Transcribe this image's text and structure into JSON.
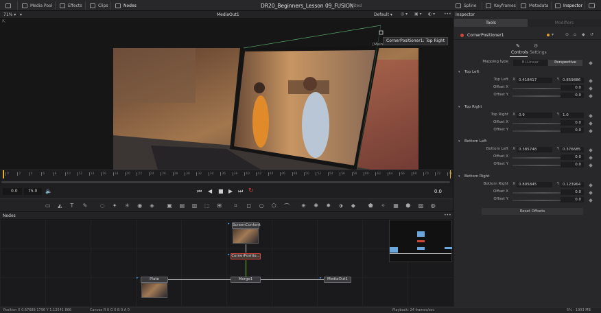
{
  "topbar": {
    "items": [
      "Media Pool",
      "Effects",
      "Clips",
      "Nodes"
    ],
    "title": "DR20_Beginners_Lesson 09_FUSION",
    "status": "Edited",
    "right_items": [
      "Spline",
      "Keyframes",
      "Metadata",
      "Inspector"
    ]
  },
  "viewer": {
    "zoom": "71%",
    "name": "MediaOut1",
    "preset": "Default",
    "tooltip": "CornerPositioner1: Top Right",
    "tag": "[Main"
  },
  "ruler": {
    "ticks": [
      "0",
      "2",
      "4",
      "6",
      "8",
      "10",
      "12",
      "14",
      "16",
      "18",
      "20",
      "22",
      "24",
      "26",
      "28",
      "30",
      "32",
      "34",
      "36",
      "38",
      "40",
      "42",
      "44",
      "46",
      "48",
      "50",
      "52",
      "54",
      "56",
      "58",
      "60",
      "62",
      "64",
      "66",
      "68",
      "70",
      "72",
      "74"
    ]
  },
  "transport": {
    "start": "0.0",
    "end": "75.0",
    "current": "0.0"
  },
  "nodes_panel": {
    "title": "Nodes",
    "screen_content": "ScreenContent",
    "corner_positioner": "CornerPositio...",
    "plate": "Plate",
    "merge": "Merge1",
    "media_out": "MediaOut1"
  },
  "inspector": {
    "title": "Inspector",
    "tabs": [
      "Tools",
      "Modifiers"
    ],
    "tool_name": "CornerPositioner1",
    "subtabs": [
      "Controls",
      "Settings"
    ],
    "mapping_label": "Mapping type",
    "mapping_options": [
      "Bi-Linear",
      "Perspective"
    ],
    "sections": [
      {
        "title": "Top Left",
        "point_label": "Top Left",
        "x": "0.418417",
        "y": "0.859886",
        "offset_x": "0.0",
        "offset_y": "0.0"
      },
      {
        "title": "Top Right",
        "point_label": "Top Right",
        "x": "0.9",
        "y": "1.0",
        "offset_x": "0.0",
        "offset_y": "0.0"
      },
      {
        "title": "Bottom Left",
        "point_label": "Bottom Left",
        "x": "0.385748",
        "y": "0.376685",
        "offset_x": "0.0",
        "offset_y": "0.0"
      },
      {
        "title": "Bottom Right",
        "point_label": "Bottom Right",
        "x": "0.805845",
        "y": "0.123964",
        "offset_x": "0.0",
        "offset_y": "0.0"
      }
    ],
    "offset_x_label": "Offset X",
    "offset_y_label": "Offset Y",
    "x_label": "X",
    "y_label": "Y",
    "reset_label": "Reset Offsets"
  },
  "statusbar": {
    "position": "Position  X 0.67688    1796  Y 1.12541    866",
    "channels": "Canvas  R 0                G 0                B 0                A 0",
    "playback": "Playback: 24 frames/sec",
    "memory": "5% - 1993 MB"
  },
  "colors": {
    "accent_red": "#d4473a",
    "playhead_yellow": "#e8b325",
    "active_tab": "#3a3a3d"
  }
}
